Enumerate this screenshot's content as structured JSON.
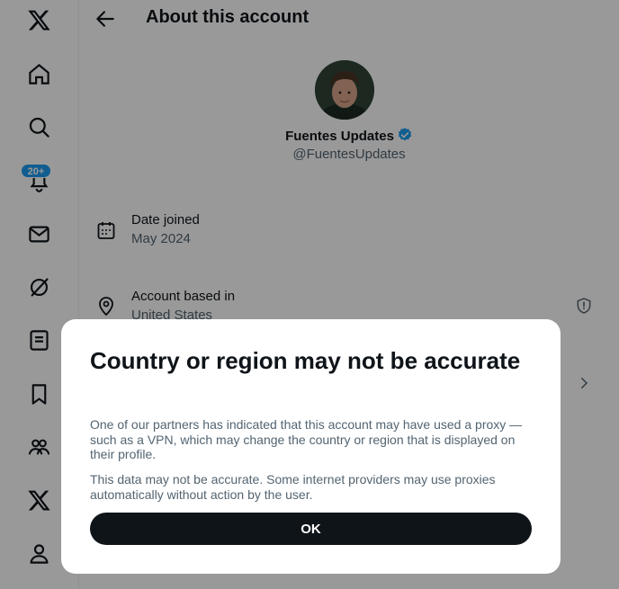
{
  "header": {
    "title": "About this account"
  },
  "profile": {
    "name": "Fuentes Updates",
    "handle": "@FuentesUpdates"
  },
  "sidebar": {
    "items": [
      {
        "icon": "x-logo-icon"
      },
      {
        "icon": "home-icon"
      },
      {
        "icon": "search-icon"
      },
      {
        "icon": "bell-icon",
        "badge": "20+"
      },
      {
        "icon": "mail-icon"
      },
      {
        "icon": "grok-icon"
      },
      {
        "icon": "list-icon"
      },
      {
        "icon": "bookmark-icon"
      },
      {
        "icon": "communities-icon"
      },
      {
        "icon": "premium-x-icon"
      },
      {
        "icon": "profile-icon"
      }
    ]
  },
  "info": {
    "date_joined": {
      "label": "Date joined",
      "value": "May 2024"
    },
    "based_in": {
      "label": "Account based in",
      "value": "United States"
    }
  },
  "dialog": {
    "title": "Country or region may not be accurate",
    "paragraph1": "One of our partners has indicated that this account may have used a proxy — such as a VPN, which may change the country or region that is displayed on their profile.",
    "paragraph2": "This data may not be accurate. Some internet providers may use proxies automatically without action by the user.",
    "ok_label": "OK"
  },
  "colors": {
    "accent": "#1d9bf0",
    "text": "#0f1419",
    "secondary": "#536471"
  }
}
